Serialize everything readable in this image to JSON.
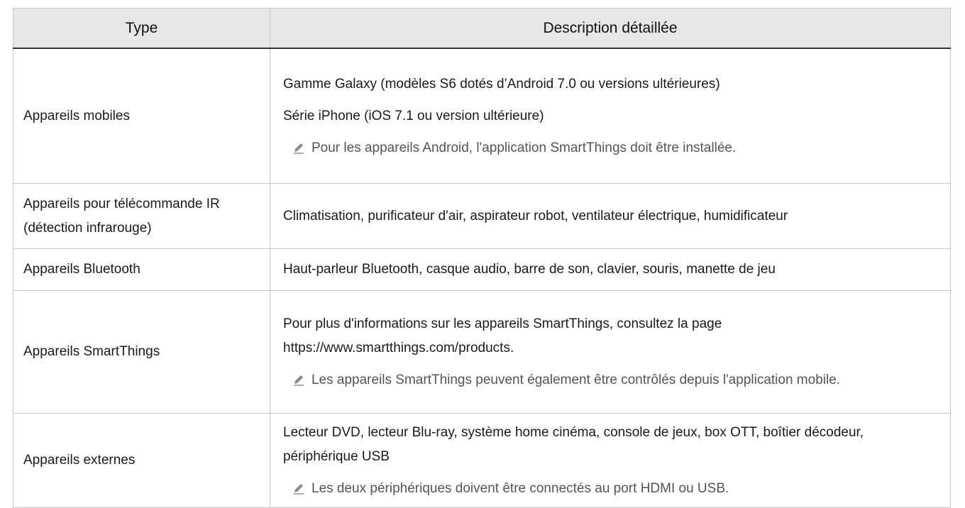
{
  "table": {
    "headers": {
      "type": "Type",
      "description": "Description détaillée"
    },
    "rows": [
      {
        "type": "Appareils mobiles",
        "lines": [
          "Gamme Galaxy (modèles S6 dotés d’Android 7.0 ou versions ultérieures)",
          "Série iPhone (iOS 7.1 ou version ultérieure)"
        ],
        "note": "Pour les appareils Android, l'application SmartThings doit être installée."
      },
      {
        "type": "Appareils pour télécommande IR (détection infrarouge)",
        "lines": [
          "Climatisation, purificateur d'air, aspirateur robot, ventilateur électrique, humidificateur"
        ]
      },
      {
        "type": "Appareils Bluetooth",
        "lines": [
          "Haut-parleur Bluetooth, casque audio, barre de son, clavier, souris, manette de jeu"
        ]
      },
      {
        "type": "Appareils SmartThings",
        "lines": [
          "Pour plus d'informations sur les appareils SmartThings, consultez la page https://www.smartthings.com/products."
        ],
        "note": "Les appareils SmartThings peuvent également être contrôlés depuis l'application mobile."
      },
      {
        "type": "Appareils externes",
        "lines": [
          "Lecteur DVD, lecteur Blu-ray, système home cinéma, console de jeux, box OTT, boîtier décodeur, périphérique USB"
        ],
        "note": "Les deux périphériques doivent être connectés au port HDMI ou USB."
      }
    ]
  },
  "icons": {
    "note_icon": "pencil-note-icon"
  },
  "colors": {
    "header_bg": "#e7e7e7",
    "border": "#c9c9c9",
    "note_text": "#555555"
  }
}
